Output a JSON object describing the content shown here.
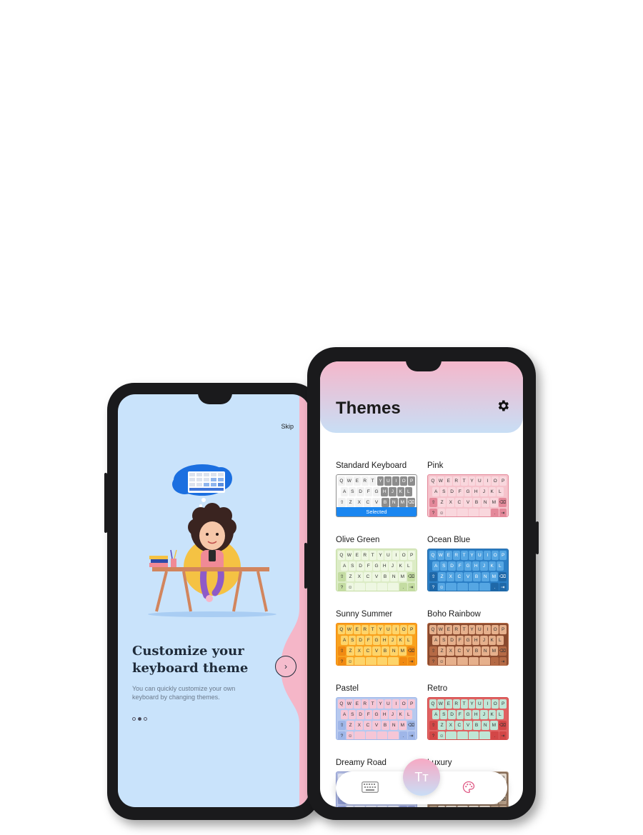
{
  "onboarding": {
    "skip_label": "Skip",
    "title": "Customize your keyboard theme",
    "description": "You can quickly customize your own keyboard by changing themes.",
    "pages": 3,
    "current_page": 2,
    "next_icon": "chevron-right-icon"
  },
  "themes_screen": {
    "title": "Themes",
    "settings_icon": "gear-icon",
    "selected_label": "Selected",
    "keyboard_rows": [
      [
        "Q",
        "W",
        "E",
        "R",
        "T",
        "Y",
        "U",
        "I",
        "O",
        "P"
      ],
      [
        "A",
        "S",
        "D",
        "F",
        "G",
        "H",
        "J",
        "K",
        "L"
      ],
      [
        "⇧",
        "Z",
        "X",
        "C",
        "V",
        "B",
        "N",
        "M",
        "⌫"
      ],
      [
        "?123",
        "☺",
        "",
        "",
        "",
        "",
        ".",
        "⇥"
      ]
    ],
    "themes": [
      {
        "name": "Standard Keyboard",
        "bg": "#ffffff",
        "key": "#f2f2f2",
        "alt": "#8d8d8d",
        "text": "#333333",
        "selected": true
      },
      {
        "name": "Pink",
        "bg": "#f6c3cc",
        "key": "#f9d7dd",
        "alt": "#e4899a",
        "text": "#333333",
        "selected": false
      },
      {
        "name": "Olive Green",
        "bg": "#dcecc6",
        "key": "#eef7e2",
        "alt": "#c4dca2",
        "text": "#333333",
        "selected": false
      },
      {
        "name": "Ocean Blue",
        "bg": "#2b7fc6",
        "key": "#55a6e3",
        "alt": "#1f68a8",
        "text": "#ffffff",
        "selected": false
      },
      {
        "name": "Sunny Summer",
        "bg": "#f9a21e",
        "key": "#fdd46a",
        "alt": "#f18a12",
        "text": "#333333",
        "selected": false
      },
      {
        "name": "Boho Rainbow",
        "bg": "#8a4a2e",
        "key": "#e6b08c",
        "alt": "#b56a45",
        "text": "#333333",
        "selected": false
      },
      {
        "name": "Pastel",
        "bg": "#b7c9ef",
        "key": "#f6c6d6",
        "alt": "#9fb6e8",
        "text": "#333333",
        "selected": false
      },
      {
        "name": "Retro",
        "bg": "#e06262",
        "key": "#bfe6d6",
        "alt": "#d34747",
        "text": "#333333",
        "selected": false
      },
      {
        "name": "Dreamy Road",
        "bg": "#b5bfe4",
        "key": "#e3e7f6",
        "alt": "#8f9bd2",
        "text": "#333333",
        "selected": false
      },
      {
        "name": "Luxury",
        "bg": "#8a6f5a",
        "key": "#e9ded2",
        "alt": "#b79f88",
        "text": "#333333",
        "selected": false
      }
    ],
    "nav": {
      "keyboard_icon": "keyboard-icon",
      "fab_label": "Tт",
      "palette_icon": "palette-icon"
    }
  }
}
